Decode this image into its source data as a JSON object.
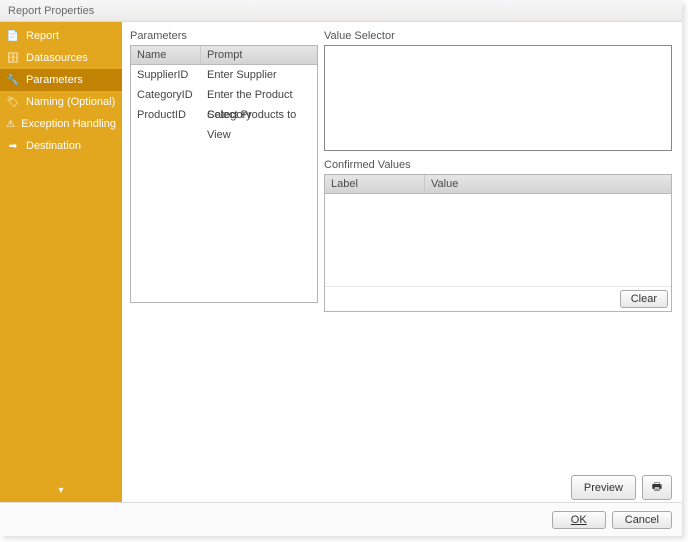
{
  "window": {
    "title": "Report Properties"
  },
  "sidebar": {
    "items": [
      {
        "label": "Report",
        "icon": "report-icon",
        "glyph": "📄"
      },
      {
        "label": "Datasources",
        "icon": "datasource-icon",
        "glyph": "🗄"
      },
      {
        "label": "Parameters",
        "icon": "parameters-icon",
        "glyph": "🔧"
      },
      {
        "label": "Naming (Optional)",
        "icon": "naming-icon",
        "glyph": "🏷"
      },
      {
        "label": "Exception Handling",
        "icon": "exception-icon",
        "glyph": "⚠"
      },
      {
        "label": "Destination",
        "icon": "destination-icon",
        "glyph": "➡"
      }
    ],
    "selected_index": 2
  },
  "parameters": {
    "section_label": "Parameters",
    "columns": {
      "name": "Name",
      "prompt": "Prompt"
    },
    "rows": [
      {
        "name": "SupplierID",
        "prompt": "Enter Supplier"
      },
      {
        "name": "CategoryID",
        "prompt": "Enter the Product Category"
      },
      {
        "name": "ProductID",
        "prompt": "Select Products to View"
      }
    ]
  },
  "value_selector": {
    "section_label": "Value Selector"
  },
  "confirmed": {
    "section_label": "Confirmed Values",
    "columns": {
      "label": "Label",
      "value": "Value"
    },
    "rows": [],
    "clear_label": "Clear"
  },
  "footer": {
    "preview_label": "Preview",
    "ok_label": "OK",
    "cancel_label": "Cancel"
  }
}
